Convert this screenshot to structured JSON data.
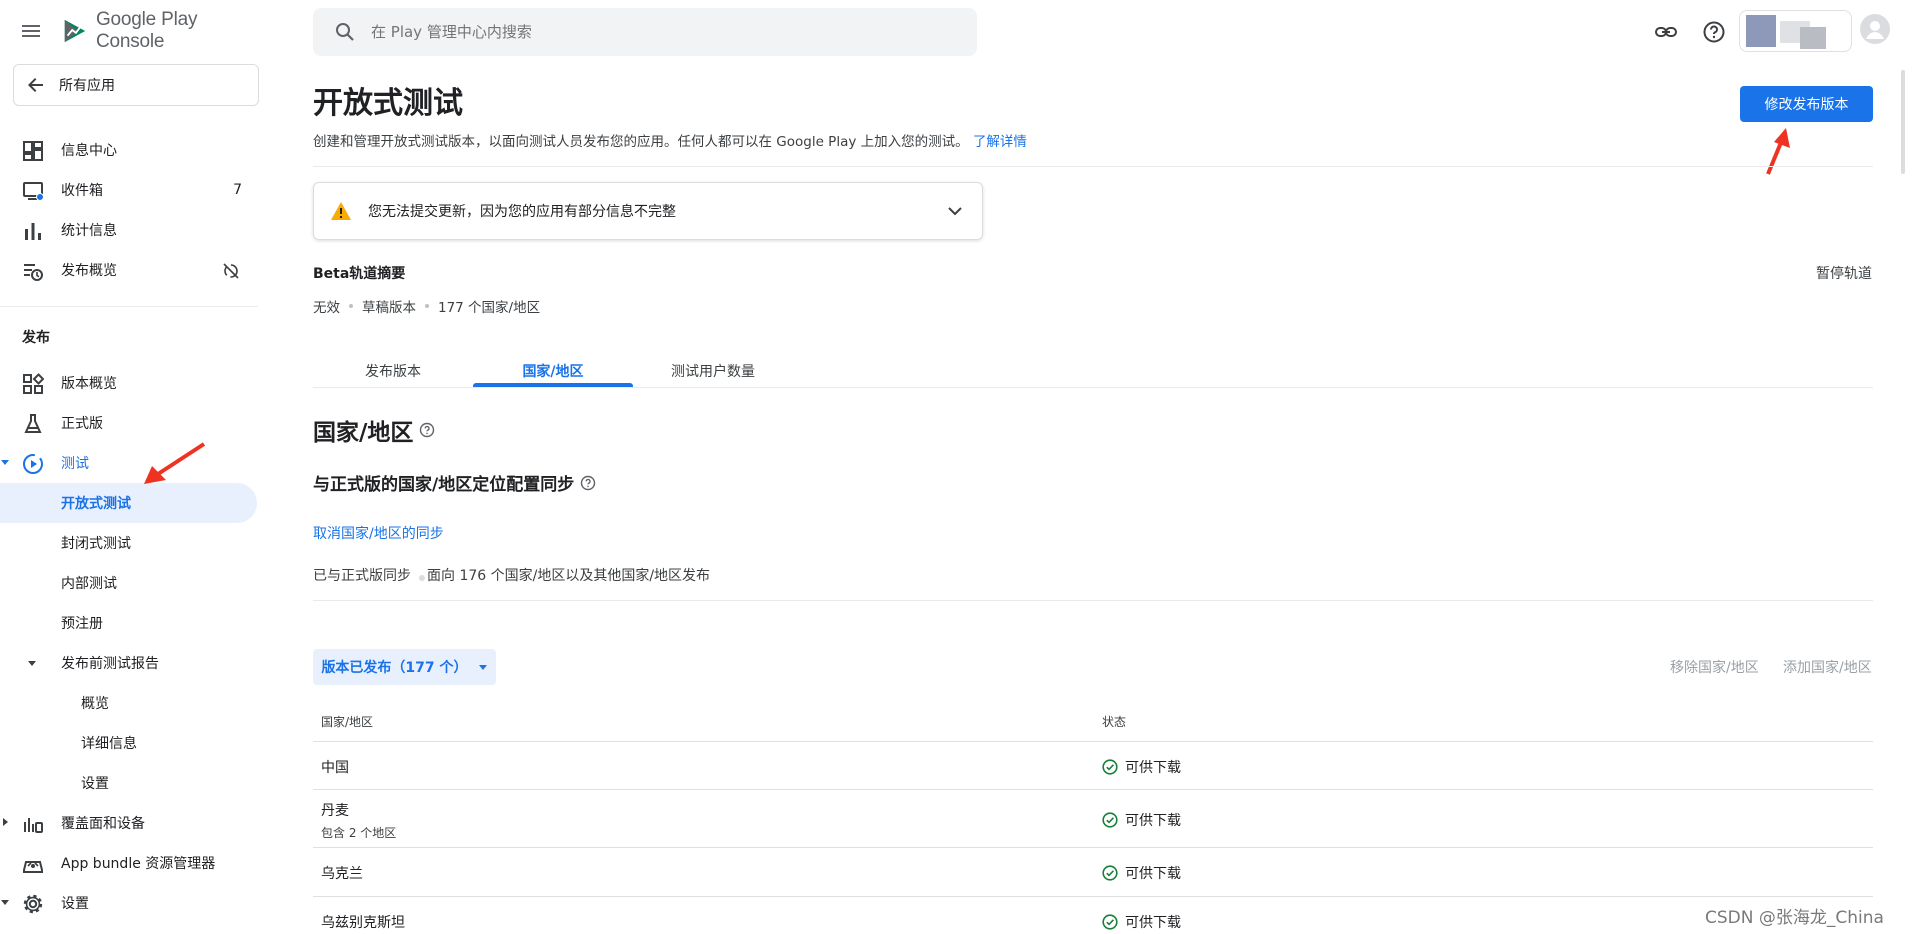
{
  "app": {
    "logo_text": "Google Play Console",
    "back_label": "所有应用"
  },
  "sidebar": {
    "items": [
      {
        "label": "信息中心",
        "icon": "dashboard-icon"
      },
      {
        "label": "收件箱",
        "icon": "inbox-icon",
        "count": "7"
      },
      {
        "label": "统计信息",
        "icon": "bar-chart-icon"
      },
      {
        "label": "发布概览",
        "icon": "publish-overview-icon"
      }
    ],
    "section_title": "发布",
    "release_items": [
      {
        "label": "版本概览",
        "icon": "grid-icon"
      },
      {
        "label": "正式版",
        "icon": "flask-icon"
      },
      {
        "label": "测试",
        "icon": "play-circle-icon"
      }
    ],
    "test_items": [
      "开放式测试",
      "封闭式测试",
      "内部测试",
      "预注册"
    ],
    "prelaunch": {
      "label": "发布前测试报告",
      "children": [
        "概览",
        "详细信息",
        "设置"
      ]
    },
    "bottom_items": [
      {
        "label": "覆盖面和设备",
        "icon": "coverage-icon"
      },
      {
        "label": "App bundle 资源管理器",
        "icon": "bundle-icon"
      },
      {
        "label": "设置",
        "icon": "settings-icon"
      }
    ]
  },
  "topbar": {
    "search_placeholder": "在 Play 管理中心内搜索"
  },
  "main": {
    "title": "开放式测试",
    "description": "创建和管理开放式测试版本，以面向测试人员发布您的应用。任何人都可以在 Google Play 上加入您的测试。",
    "learn_more": "了解详情",
    "edit_release_button": "修改发布版本",
    "warning_text": "您无法提交更新，因为您的应用有部分信息不完整",
    "summary_title": "Beta轨道摘要",
    "pause_track": "暂停轨道",
    "summary_meta": [
      "无效",
      "草稿版本",
      "177 个国家/地区"
    ],
    "tabs": [
      "发布版本",
      "国家/地区",
      "测试用户数量"
    ],
    "active_tab": "国家/地区",
    "countries_title": "国家/地区",
    "sync_title": "与正式版的国家/地区定位配置同步",
    "cancel_sync": "取消国家/地区的同步",
    "sync_status": "已与正式版同步",
    "sync_detail": "面向 176 个国家/地区以及其他国家/地区发布",
    "filter_chip": "版本已发布（177 个）",
    "remove_countries": "移除国家/地区",
    "add_countries": "添加国家/地区",
    "table": {
      "headers": [
        "国家/地区",
        "状态"
      ],
      "rows": [
        {
          "country": "中国",
          "sub": "",
          "status": "可供下载"
        },
        {
          "country": "丹麦",
          "sub": "包含 2 个地区",
          "status": "可供下载"
        },
        {
          "country": "乌克兰",
          "sub": "",
          "status": "可供下载"
        },
        {
          "country": "乌兹别克斯坦",
          "sub": "",
          "status": "可供下载"
        }
      ]
    }
  },
  "watermark": "CSDN @张海龙_China",
  "colors": {
    "accent": "#1a73e8",
    "active_bg": "#e8f0fe",
    "success": "#188038",
    "warning": "#f9ab00",
    "annotation_arrow": "#ee3322"
  }
}
